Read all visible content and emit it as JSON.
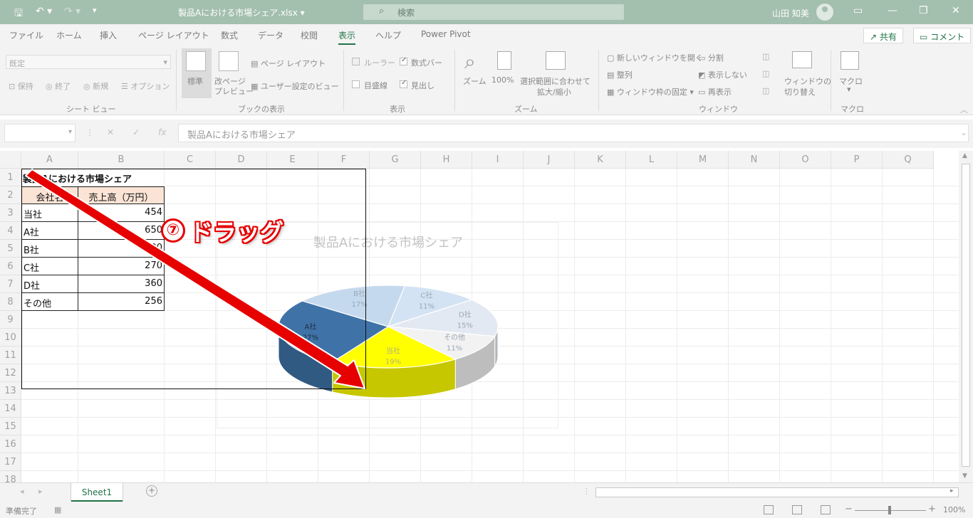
{
  "title_bar": {
    "doc_title": "製品Aにおける市場シェア.xlsx ▾",
    "search_placeholder": "検索",
    "user_name": "山田 知美",
    "save_icon": "save-icon",
    "undo_icon": "undo-icon",
    "redo_icon": "redo-icon"
  },
  "ribbon": {
    "tabs": [
      "ファイル",
      "ホーム",
      "挿入",
      "ページ レイアウト",
      "数式",
      "データ",
      "校閲",
      "表示",
      "ヘルプ",
      "Power Pivot"
    ],
    "active_tab": "表示",
    "share_label": "共有",
    "comment_label": "コメント",
    "sheet_view": {
      "dropdown_value": "既定",
      "keep": "保持",
      "exit": "終了",
      "new": "新規",
      "options": "オプション",
      "label": "シート ビュー"
    },
    "workbook_views": {
      "normal": "標準",
      "page_break_1": "改ページ",
      "page_break_2": "プレビュー",
      "page_layout": "ページ レイアウト",
      "custom_views": "ユーザー設定のビュー",
      "label": "ブックの表示"
    },
    "show": {
      "ruler": "ルーラー",
      "formula_bar": "数式バー",
      "gridlines": "目盛線",
      "headings": "見出し",
      "label": "表示"
    },
    "zoom": {
      "zoom": "ズーム",
      "zoom_100": "100%",
      "zoom_sel_1": "選択範囲に合わせて",
      "zoom_sel_2": "拡大/縮小",
      "label": "ズーム"
    },
    "window": {
      "new_window": "新しいウィンドウを開く",
      "arrange": "整列",
      "freeze": "ウィンドウ枠の固定",
      "split": "分割",
      "hide": "表示しない",
      "unhide": "再表示",
      "switch_1": "ウィンドウの",
      "switch_2": "切り替え",
      "label": "ウィンドウ"
    },
    "macro": {
      "macro": "マクロ",
      "label": "マクロ"
    }
  },
  "formula_bar": {
    "content": "製品Aにおける市場シェア"
  },
  "sheet": {
    "columns": [
      "A",
      "B",
      "C",
      "D",
      "E",
      "F",
      "G",
      "H",
      "I",
      "J",
      "K",
      "L",
      "M",
      "N",
      "O",
      "P",
      "Q"
    ],
    "rows": [
      "1",
      "2",
      "3",
      "4",
      "5",
      "6",
      "7",
      "8",
      "9",
      "10",
      "11",
      "12",
      "13",
      "14",
      "15",
      "16",
      "17",
      "18"
    ],
    "table_title": "製品Aにおける市場シェア",
    "table_headers": [
      "会社名",
      "売上高（万円）"
    ],
    "table_rows": [
      [
        "当社",
        "454"
      ],
      [
        "A社",
        "650"
      ],
      [
        "B社",
        "400"
      ],
      [
        "C社",
        "270"
      ],
      [
        "D社",
        "360"
      ],
      [
        "その他",
        "256"
      ]
    ]
  },
  "annotation": {
    "step_number": "⑦",
    "text": "ドラッグ"
  },
  "chart_data": {
    "type": "pie",
    "title": "製品Aにおける市場シェア",
    "categories": [
      "当社",
      "A社",
      "B社",
      "C社",
      "D社",
      "その他"
    ],
    "values": [
      454,
      650,
      400,
      270,
      360,
      256
    ],
    "data_labels": [
      "19%",
      "27%",
      "17%",
      "11%",
      "15%",
      "11%"
    ],
    "colors": {
      "当社": "#ffff00",
      "A社": "#3f73a8",
      "B社": "#c5d9ee",
      "C社": "#d3e3f3",
      "D社": "#e3e9f2",
      "その他": "#f2f2f2"
    },
    "style": "3d"
  },
  "sheet_tabs": {
    "active": "Sheet1"
  },
  "status_bar": {
    "status": "準備完了",
    "zoom": "100%"
  },
  "colors": {
    "title_bar": "#a3bfad",
    "accent": "#217346",
    "annotation_red": "#e60000",
    "header_fill": "#fbe4d5"
  }
}
